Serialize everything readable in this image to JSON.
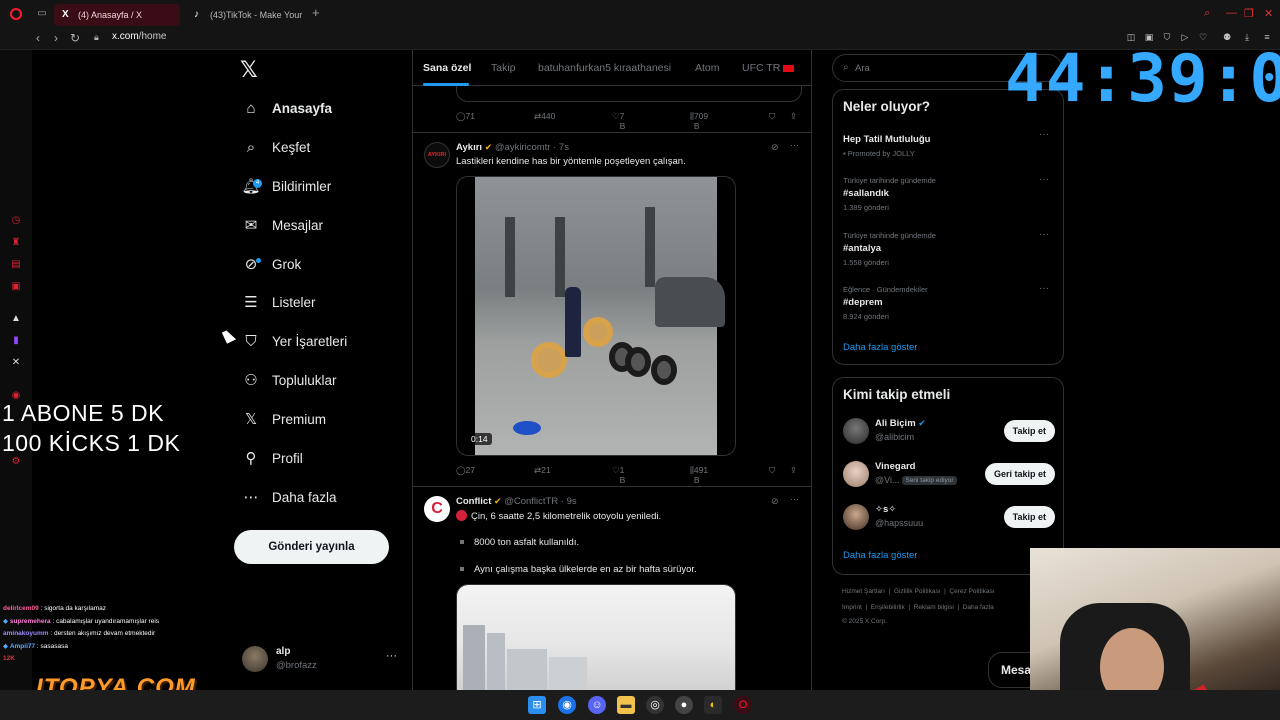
{
  "browser": {
    "tabs": [
      {
        "label": "(4) Anasayfa / X",
        "active": true
      },
      {
        "label": "(43)TikTok - Make Your D",
        "active": false
      }
    ],
    "url_host": "x.com",
    "url_path": "/home"
  },
  "x_nav": {
    "items": [
      {
        "label": "Anasayfa",
        "icon": "home-icon",
        "active": true
      },
      {
        "label": "Keşfet",
        "icon": "search-icon"
      },
      {
        "label": "Bildirimler",
        "icon": "bell-icon",
        "badge": "4"
      },
      {
        "label": "Mesajlar",
        "icon": "mail-icon"
      },
      {
        "label": "Grok",
        "icon": "grok-icon"
      },
      {
        "label": "Listeler",
        "icon": "list-icon"
      },
      {
        "label": "Yer İşaretleri",
        "icon": "bookmark-icon"
      },
      {
        "label": "Topluluklar",
        "icon": "communities-icon"
      },
      {
        "label": "Premium",
        "icon": "x-logo-icon"
      },
      {
        "label": "Profil",
        "icon": "person-icon"
      },
      {
        "label": "Daha fazla",
        "icon": "more-circle-icon"
      }
    ],
    "post_button": "Gönderi yayınla",
    "account": {
      "name": "alp",
      "handle": "@brofazz"
    }
  },
  "timeline": {
    "tabs": [
      "Sana özel",
      "Takip",
      "batuhanfurkan5 kıraathanesi",
      "Atom",
      "UFC TR"
    ],
    "top_stats": {
      "replies": "71",
      "reposts": "440",
      "likes": "7 B",
      "views": "709 B"
    },
    "tweets": [
      {
        "name": "Aykırı",
        "handle": "@aykiricomtr",
        "time": "7s",
        "avatar_text": "AYKIRI",
        "text": "Lastikleri kendine has bir yöntemle poşetleyen çalışan.",
        "video_duration": "0:14",
        "stats": {
          "replies": "27",
          "reposts": "21",
          "likes": "1 B",
          "views": "491 B"
        }
      },
      {
        "name": "Conflict",
        "handle": "@ConflictTR",
        "time": "9s",
        "avatar_text": "C",
        "lines": [
          "Çin, 6 saatte 2,5 kilometrelik otoyolu yeniledi.",
          "8000 ton asfalt kullanıldı.",
          "Aynı çalışma başka ülkelerde en az bir hafta sürüyor."
        ]
      }
    ]
  },
  "right": {
    "search_placeholder": "Ara",
    "trends_title": "Neler oluyor?",
    "trends": [
      {
        "meta": "",
        "title": "Hep Tatil Mutluluğu",
        "count": "Promoted by JOLLY"
      },
      {
        "meta": "Türkiye tarihinde gündemde",
        "title": "#sallandık",
        "count": "1.389 gönderi"
      },
      {
        "meta": "Türkiye tarihinde gündemde",
        "title": "#antalya",
        "count": "1.558 gönderi"
      },
      {
        "meta": "Eğlence · Gündemdekiler",
        "title": "#deprem",
        "count": "8.924 gönderi"
      }
    ],
    "show_more": "Daha fazla göster",
    "who_title": "Kimi takip etmeli",
    "who": [
      {
        "name": "Ali Biçim",
        "handle": "@alibicim",
        "button": "Takip et",
        "verified": true
      },
      {
        "name": "Vinegard",
        "handle": "@Vi...",
        "follows_you": "Seni takip ediyor",
        "button": "Geri takip et"
      },
      {
        "name": "✧s✧",
        "handle": "@hapssuuu",
        "button": "Takip et"
      }
    ],
    "footer_line1": [
      "Hizmet Şartları",
      "Gizlilik Politikası",
      "Çerez Politikası"
    ],
    "footer_line2": [
      "Imprint",
      "Erişilebilirlik",
      "Reklam bilgisi",
      "Daha fazla"
    ],
    "copyright": "© 2025 X Corp.",
    "messages_label": "Mesa"
  },
  "overlay": {
    "line1": "1 ABONE 5 DK",
    "line2": "100 KİCKS  1 DK",
    "timer": "44:39:09",
    "sponsor": "ITOPYA.COM",
    "chat": [
      {
        "user": "delirlcem09",
        "msg": "sigorta da karşılamaz"
      },
      {
        "user": "supremehera",
        "msg": "cabalamışlar uyandıramamışlar reis"
      },
      {
        "user": "aminakoyumm",
        "msg": "dersten akışımız devam etmektedir"
      },
      {
        "user": "Ampii77",
        "msg": "sasasasa"
      },
      {
        "user": "",
        "msg": "12K"
      }
    ]
  },
  "colors": {
    "accent": "#1d9bf0",
    "timer": "#35a8ff",
    "opera": "#ff1b2d",
    "verified_gold": "#f5b400"
  }
}
